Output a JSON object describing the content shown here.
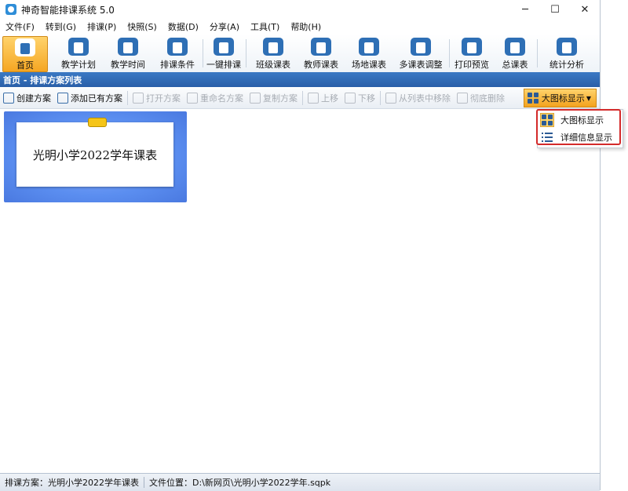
{
  "window": {
    "title": "神奇智能排课系统 5.0",
    "controls": {
      "minimize": "─",
      "maximize": "☐",
      "close": "✕"
    }
  },
  "menu": [
    "文件(F)",
    "转到(G)",
    "排课(P)",
    "快照(S)",
    "数据(D)",
    "分享(A)",
    "工具(T)",
    "帮助(H)"
  ],
  "ribbon": [
    {
      "label": "首页",
      "icon": "home-icon",
      "active": true
    },
    {
      "label": "教学计划",
      "icon": "clipboard-icon"
    },
    {
      "label": "教学时间",
      "icon": "clock-icon"
    },
    {
      "label": "排课条件",
      "icon": "network-icon"
    },
    {
      "label": "一键排课",
      "icon": "hand-pointer-icon"
    },
    {
      "label": "班级课表",
      "icon": "calendar-grid-icon"
    },
    {
      "label": "教师课表",
      "icon": "teacher-icon"
    },
    {
      "label": "场地课表",
      "icon": "building-icon"
    },
    {
      "label": "多课表调整",
      "icon": "document-gear-icon"
    },
    {
      "label": "打印预览",
      "icon": "printer-icon"
    },
    {
      "label": "总课表",
      "icon": "master-calendar-icon"
    },
    {
      "label": "统计分析",
      "icon": "bar-chart-icon"
    }
  ],
  "breadcrumb": "首页 - 排课方案列表",
  "toolbar": {
    "create": "创建方案",
    "add_existing": "添加已有方案",
    "open": "打开方案",
    "rename": "重命名方案",
    "copy": "复制方案",
    "move_up": "上移",
    "move_down": "下移",
    "remove_from_list": "从列表中移除",
    "delete": "彻底删除",
    "view_mode": "大图标显示"
  },
  "view_menu": {
    "large_icons": "大图标显示",
    "details": "详细信息显示",
    "selected": "large_icons"
  },
  "plans": [
    {
      "title": "光明小学2022学年课表"
    }
  ],
  "status": {
    "plan_label": "排课方案：",
    "plan_value": "光明小学2022学年课表",
    "path_label": "文件位置：",
    "path_value": "D:\\新网页\\光明小学2022学年.sqpk"
  },
  "colors": {
    "accent_orange": "#f5a623",
    "ribbon_blue": "#2e6fb5",
    "breadcrumb_bar": "#2a5fa8",
    "highlight_red": "#d42a2a"
  }
}
